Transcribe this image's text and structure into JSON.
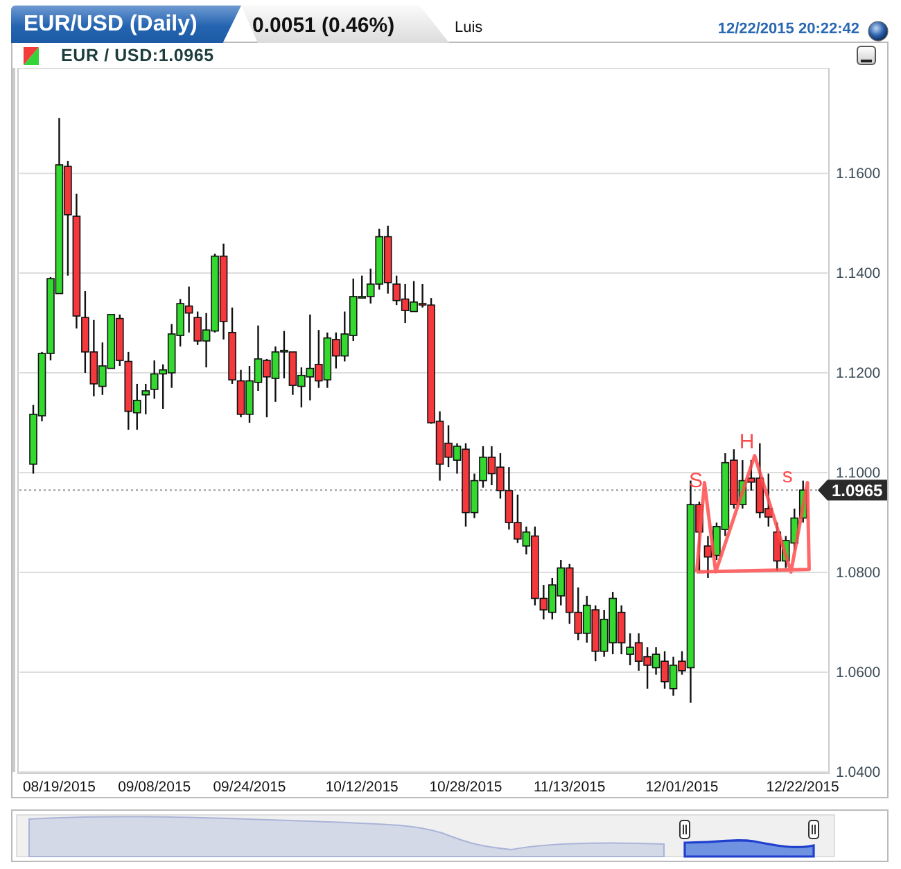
{
  "header": {
    "title": "EUR/USD (Daily)",
    "change": "0.0051 (0.46%)",
    "user": "Luis",
    "timestamp": "12/22/2015 20:22:42"
  },
  "chart_panel": {
    "legend": "EUR / USD:1.0965",
    "chart_data": {
      "type": "candlestick",
      "grid": true,
      "categories": [
        null,
        null,
        null,
        "08/19/2015",
        null,
        null,
        null,
        null,
        null,
        null,
        null,
        null,
        null,
        null,
        "09/08/2015",
        null,
        null,
        null,
        null,
        null,
        null,
        null,
        null,
        null,
        null,
        "09/24/2015",
        null,
        null,
        null,
        null,
        null,
        null,
        null,
        null,
        null,
        null,
        null,
        null,
        "10/12/2015",
        null,
        null,
        null,
        null,
        null,
        null,
        null,
        null,
        null,
        null,
        null,
        "10/28/2015",
        null,
        null,
        null,
        null,
        null,
        null,
        null,
        null,
        null,
        null,
        null,
        "11/13/2015",
        null,
        null,
        null,
        null,
        null,
        null,
        null,
        null,
        null,
        null,
        null,
        null,
        "12/01/2015",
        null,
        null,
        null,
        null,
        null,
        null,
        null,
        null,
        null,
        null,
        null,
        null,
        null,
        "12/22/2015"
      ],
      "yticks": [
        {
          "value": 1.04,
          "label": "1.0400"
        },
        {
          "value": 1.06,
          "label": "1.0600"
        },
        {
          "value": 1.08,
          "label": "1.0800"
        },
        {
          "value": 1.1,
          "label": "1.1000"
        },
        {
          "value": 1.12,
          "label": "1.1200"
        },
        {
          "value": 1.14,
          "label": "1.1400"
        },
        {
          "value": 1.16,
          "label": "1.1600"
        }
      ],
      "ylim": [
        1.04,
        1.1803
      ],
      "ohlc": [
        [
          1.1017,
          1.1136,
          1.0998,
          1.1117
        ],
        [
          1.1114,
          1.1242,
          1.1103,
          1.1239
        ],
        [
          1.1239,
          1.1392,
          1.1225,
          1.1389
        ],
        [
          1.1359,
          1.1711,
          1.1359,
          1.1617
        ],
        [
          1.1614,
          1.1625,
          1.1395,
          1.1517
        ],
        [
          1.1514,
          1.1559,
          1.1289,
          1.1314
        ],
        [
          1.1311,
          1.1364,
          1.12,
          1.1242
        ],
        [
          1.1242,
          1.1306,
          1.1153,
          1.1178
        ],
        [
          1.1173,
          1.1261,
          1.1156,
          1.1214
        ],
        [
          1.1209,
          1.1317,
          1.1209,
          1.1317
        ],
        [
          1.1309,
          1.1317,
          1.1214,
          1.1225
        ],
        [
          1.1223,
          1.1242,
          1.1086,
          1.1123
        ],
        [
          1.112,
          1.1178,
          1.1086,
          1.1145
        ],
        [
          1.1156,
          1.1178,
          1.1117,
          1.1164
        ],
        [
          1.1167,
          1.1225,
          1.1148,
          1.1198
        ],
        [
          1.1198,
          1.1217,
          1.1128,
          1.1206
        ],
        [
          1.12,
          1.1298,
          1.117,
          1.1278
        ],
        [
          1.1275,
          1.1348,
          1.1253,
          1.1339
        ],
        [
          1.1334,
          1.1373,
          1.1281,
          1.132
        ],
        [
          1.1311,
          1.1323,
          1.1256,
          1.1264
        ],
        [
          1.1264,
          1.132,
          1.1211,
          1.1286
        ],
        [
          1.1284,
          1.1439,
          1.1281,
          1.1434
        ],
        [
          1.1434,
          1.1459,
          1.1267,
          1.1303
        ],
        [
          1.1281,
          1.1331,
          1.1178,
          1.1186
        ],
        [
          1.1184,
          1.1206,
          1.1111,
          1.1117
        ],
        [
          1.1117,
          1.1214,
          1.11,
          1.1184
        ],
        [
          1.1181,
          1.1295,
          1.1164,
          1.1228
        ],
        [
          1.1225,
          1.1228,
          1.1111,
          1.1192
        ],
        [
          1.1189,
          1.1253,
          1.1142,
          1.1242
        ],
        [
          1.1242,
          1.1284,
          1.1189,
          1.1245
        ],
        [
          1.1242,
          1.1242,
          1.1156,
          1.1175
        ],
        [
          1.1173,
          1.1211,
          1.1131,
          1.1195
        ],
        [
          1.1192,
          1.1317,
          1.1145,
          1.1209
        ],
        [
          1.1217,
          1.1286,
          1.117,
          1.1184
        ],
        [
          1.1186,
          1.1281,
          1.117,
          1.127
        ],
        [
          1.1267,
          1.1281,
          1.1209,
          1.1234
        ],
        [
          1.1234,
          1.1323,
          1.1223,
          1.1278
        ],
        [
          1.1275,
          1.1389,
          1.1264,
          1.1353
        ],
        [
          1.135,
          1.1395,
          1.135,
          1.1353
        ],
        [
          1.1353,
          1.1409,
          1.1339,
          1.1378
        ],
        [
          1.1378,
          1.1489,
          1.1367,
          1.1473
        ],
        [
          1.1473,
          1.1495,
          1.1359,
          1.1381
        ],
        [
          1.1378,
          1.1395,
          1.1336,
          1.1345
        ],
        [
          1.1348,
          1.1378,
          1.13,
          1.1325
        ],
        [
          1.1323,
          1.1384,
          1.1323,
          1.1342
        ],
        [
          1.1339,
          1.1378,
          1.1331,
          1.1336
        ],
        [
          1.1336,
          1.135,
          1.1098,
          1.11
        ],
        [
          1.1103,
          1.1123,
          1.0984,
          1.1017
        ],
        [
          1.1059,
          1.1095,
          1.1011,
          1.1031
        ],
        [
          1.1025,
          1.1059,
          1.0998,
          1.1053
        ],
        [
          1.1047,
          1.1059,
          1.0892,
          1.092
        ],
        [
          1.092,
          1.0998,
          1.0909,
          1.0984
        ],
        [
          1.0984,
          1.1053,
          1.097,
          1.1031
        ],
        [
          1.1031,
          1.1053,
          1.0975,
          1.0998
        ],
        [
          1.1011,
          1.1039,
          1.0948,
          1.0964
        ],
        [
          1.0964,
          1.1011,
          1.0886,
          1.09
        ],
        [
          1.09,
          1.0956,
          1.0859,
          1.0867
        ],
        [
          1.0853,
          1.0892,
          1.0836,
          1.0881
        ],
        [
          1.0873,
          1.0892,
          1.0734,
          1.0748
        ],
        [
          1.0748,
          1.0775,
          1.0706,
          1.0725
        ],
        [
          1.072,
          1.0789,
          1.0706,
          1.0775
        ],
        [
          1.0753,
          1.0825,
          1.0734,
          1.0809
        ],
        [
          1.0809,
          1.0817,
          1.0697,
          1.072
        ],
        [
          1.072,
          1.077,
          1.0664,
          1.0678
        ],
        [
          1.0678,
          1.0753,
          1.0659,
          1.0734
        ],
        [
          1.0725,
          1.0734,
          1.0622,
          1.0642
        ],
        [
          1.0642,
          1.0725,
          1.0631,
          1.0706
        ],
        [
          1.0659,
          1.0761,
          1.0636,
          1.0748
        ],
        [
          1.072,
          1.0734,
          1.0636,
          1.0659
        ],
        [
          1.0636,
          1.0678,
          1.0614,
          1.065
        ],
        [
          1.0659,
          1.0678,
          1.0603,
          1.0622
        ],
        [
          1.0631,
          1.065,
          1.0567,
          1.0614
        ],
        [
          1.0609,
          1.065,
          1.0595,
          1.0636
        ],
        [
          1.0622,
          1.0642,
          1.0567,
          1.0581
        ],
        [
          1.0567,
          1.0631,
          1.0553,
          1.0614
        ],
        [
          1.0622,
          1.0642,
          1.0595,
          1.0603
        ],
        [
          1.0609,
          1.0984,
          1.0539,
          1.0936
        ],
        [
          1.0936,
          1.0942,
          1.0803,
          1.0881
        ],
        [
          1.0853,
          1.0873,
          1.0789,
          1.0831
        ],
        [
          1.0834,
          1.09,
          1.0825,
          1.0892
        ],
        [
          1.0886,
          1.1039,
          1.0873,
          1.102
        ],
        [
          1.1025,
          1.1047,
          1.0928,
          1.0936
        ],
        [
          1.0936,
          1.1025,
          1.0928,
          1.0984
        ],
        [
          1.0989,
          1.1025,
          1.0964,
          1.0981
        ],
        [
          1.0989,
          1.1059,
          1.0909,
          1.092
        ],
        [
          1.0928,
          1.0998,
          1.0892,
          1.0911
        ],
        [
          1.0881,
          1.09,
          1.0803,
          1.0823
        ],
        [
          1.0823,
          1.0873,
          1.0809,
          1.0864
        ],
        [
          1.0859,
          1.0928,
          1.0845,
          1.0909
        ],
        [
          1.0909,
          1.0984,
          1.09,
          1.0965
        ]
      ],
      "ref_lines": [
        {
          "axis": "y",
          "value": 1.0965,
          "label": "1.0965"
        }
      ],
      "annotations": [
        "S",
        "H",
        "s"
      ]
    }
  }
}
